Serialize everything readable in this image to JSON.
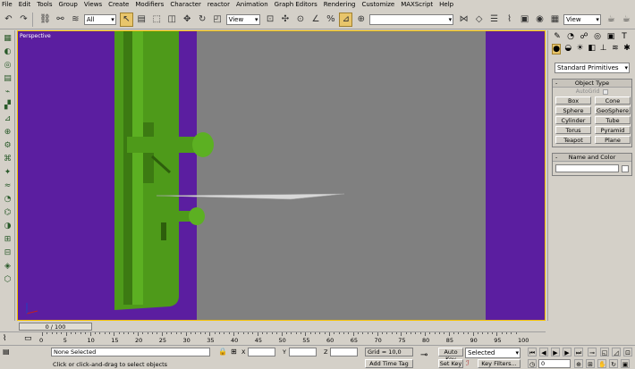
{
  "menu": [
    "File",
    "Edit",
    "Tools",
    "Group",
    "Views",
    "Create",
    "Modifiers",
    "Character",
    "reactor",
    "Animation",
    "Graph Editors",
    "Rendering",
    "Customize",
    "MAXScript",
    "Help"
  ],
  "toolbar": {
    "selection_filter": "All",
    "ref_coord": "View",
    "named_selection": "",
    "render_view": "View"
  },
  "viewport": {
    "label": "Perspective",
    "background_color": "#808080",
    "side_color": "#5b1ea0",
    "model_color": "#4e9a1a",
    "active_border": "#f4c000"
  },
  "command_panel": {
    "primitive_type": "Standard Primitives",
    "object_type_title": "Object Type",
    "autogrid_label": "AutoGrid",
    "buttons": [
      "Box",
      "Cone",
      "Sphere",
      "GeoSphere",
      "Cylinder",
      "Tube",
      "Torus",
      "Pyramid",
      "Teapot",
      "Plane"
    ],
    "name_color_title": "Name and Color",
    "name_value": ""
  },
  "time": {
    "slider_label": "0 / 100",
    "ticks": [
      "0",
      "5",
      "10",
      "15",
      "20",
      "25",
      "30",
      "35",
      "40",
      "45",
      "50",
      "55",
      "60",
      "65",
      "70",
      "75",
      "80",
      "85",
      "90",
      "95",
      "100"
    ]
  },
  "status": {
    "selection": "None Selected",
    "prompt": "Click or click-and-drag to select objects",
    "x_label": "X",
    "y_label": "Y",
    "z_label": "Z",
    "x_value": "",
    "y_value": "",
    "z_value": "",
    "grid": "Grid = 10,0",
    "add_time_tag": "Add Time Tag",
    "auto_key": "Auto Key",
    "set_key": "Set Key",
    "key_mode": "Selected",
    "key_filters": "Key Filters...",
    "frame": "0"
  }
}
